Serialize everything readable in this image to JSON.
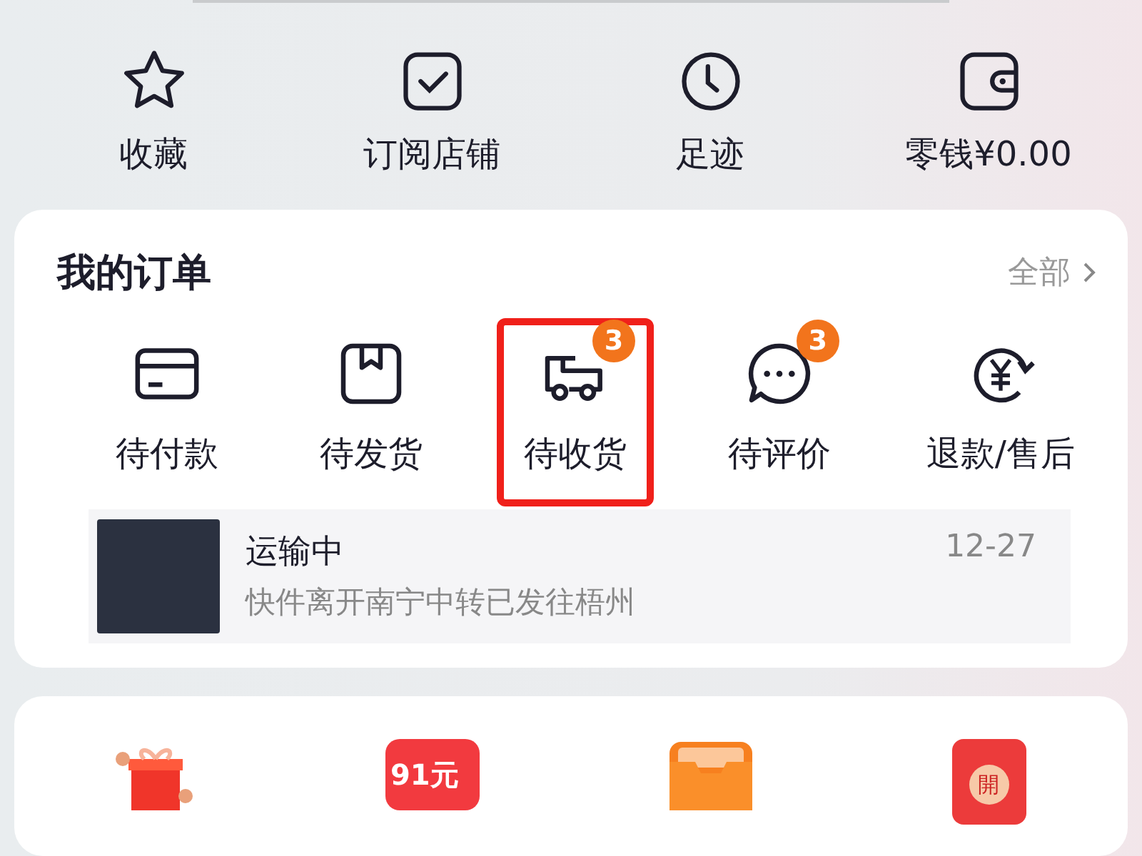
{
  "quick_links": [
    {
      "kind": "star",
      "label": "收藏"
    },
    {
      "kind": "check",
      "label": "订阅店铺"
    },
    {
      "kind": "clock",
      "label": "足迹"
    },
    {
      "kind": "wallet",
      "label": "零钱¥0.00"
    }
  ],
  "orders": {
    "title": "我的订单",
    "all_link": "全部",
    "items": [
      {
        "kind": "card",
        "label": "待付款",
        "highlighted": false
      },
      {
        "kind": "box",
        "label": "待发货",
        "highlighted": false
      },
      {
        "kind": "truck",
        "label": "待收货",
        "badge": "3",
        "highlighted": true
      },
      {
        "kind": "chat",
        "label": "待评价",
        "badge": "3",
        "highlighted": false
      },
      {
        "kind": "refund",
        "label": "退款/售后",
        "highlighted": false
      }
    ],
    "tracking": {
      "status": "运输中",
      "detail": "快件离开南宁中转已发往梧州",
      "date": "12-27"
    }
  },
  "promos": [
    {
      "kind": "gift"
    },
    {
      "kind": "coupon",
      "text": "91元"
    },
    {
      "kind": "wallet"
    },
    {
      "kind": "redpacket",
      "text": "開"
    }
  ]
}
